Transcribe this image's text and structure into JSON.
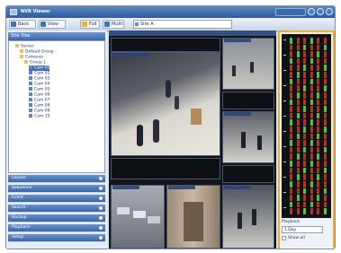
{
  "window": {
    "title": "NVR Viewer",
    "min_icon": "minimize-icon",
    "max_icon": "maximize-icon",
    "close_icon": "close-icon"
  },
  "toolbar": {
    "back_label": "Back",
    "view_label": "View",
    "full_label": "Full",
    "multi_label": "Multi",
    "address_text": "Site A"
  },
  "left_panel": {
    "header": "Site Tree",
    "tree": [
      {
        "label": "Server",
        "indent": 1,
        "icon": "folder-icon"
      },
      {
        "label": "Default Group",
        "indent": 2,
        "icon": "folder-icon"
      },
      {
        "label": "Cameras",
        "indent": 2,
        "icon": "folder-icon"
      },
      {
        "label": "Group 1",
        "indent": 3,
        "icon": "folder-icon"
      },
      {
        "label": "Cam 01",
        "indent": 4,
        "icon": "camera-icon",
        "selected": true
      },
      {
        "label": "Cam 02",
        "indent": 4,
        "icon": "camera-icon"
      },
      {
        "label": "Cam 03",
        "indent": 4,
        "icon": "camera-icon"
      },
      {
        "label": "Cam 04",
        "indent": 4,
        "icon": "camera-icon"
      },
      {
        "label": "Cam 05",
        "indent": 4,
        "icon": "camera-icon"
      },
      {
        "label": "Cam 06",
        "indent": 4,
        "icon": "camera-icon"
      },
      {
        "label": "Cam 07",
        "indent": 4,
        "icon": "camera-icon"
      },
      {
        "label": "Cam 08",
        "indent": 4,
        "icon": "camera-icon"
      },
      {
        "label": "Cam 09",
        "indent": 4,
        "icon": "camera-icon"
      },
      {
        "label": "Cam 10",
        "indent": 4,
        "icon": "camera-icon"
      }
    ],
    "accordion": [
      "Layout",
      "Sequence",
      "Event",
      "Search",
      "Backup",
      "Playback",
      "Setup"
    ]
  },
  "timeline": {
    "tracks": 6,
    "label": "Playback",
    "select_value": "1 Day",
    "check_label": "Show all"
  },
  "colors": {
    "accent": "#3c66a8",
    "highlight": "#f2b02a",
    "green": "#5bbf3a",
    "red": "#b23225"
  }
}
